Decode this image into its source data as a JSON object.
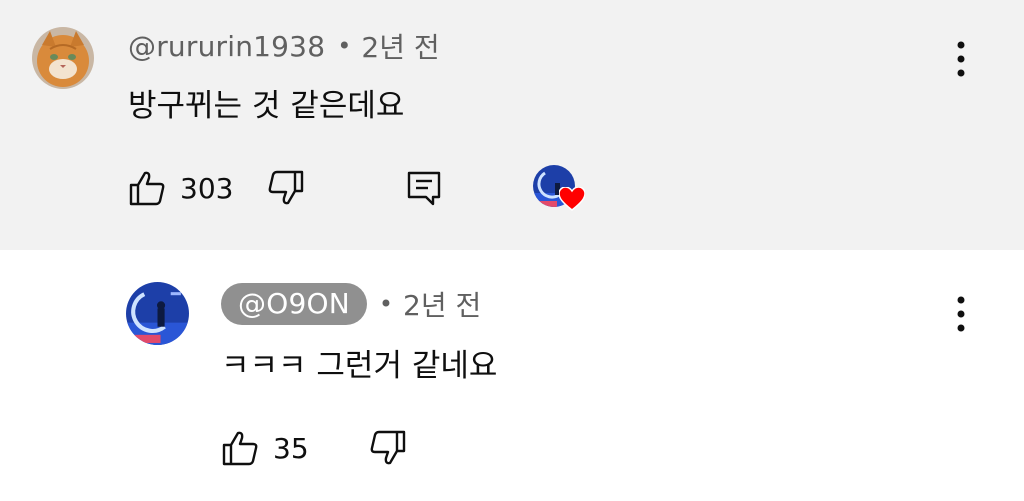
{
  "comments": [
    {
      "author": "@rururin1938",
      "time": "2년 전",
      "text": "방구뀌는 것 같은데요",
      "likes": "303",
      "avatar_icon": "cat-avatar",
      "creator_heart": true
    },
    {
      "author": "@O9ON",
      "time": "2년 전",
      "text": "ㅋㅋㅋ 그런거 같네요",
      "likes": "35",
      "avatar_icon": "blue-stage-avatar"
    }
  ],
  "separator": "•",
  "colors": {
    "top_bg": "#f2f2f2",
    "chip_bg": "#909090",
    "muted": "#606060",
    "heart": "#ff0000"
  },
  "icons": [
    "like-icon",
    "dislike-icon",
    "reply-icon",
    "more-vert-icon",
    "heart-icon"
  ]
}
